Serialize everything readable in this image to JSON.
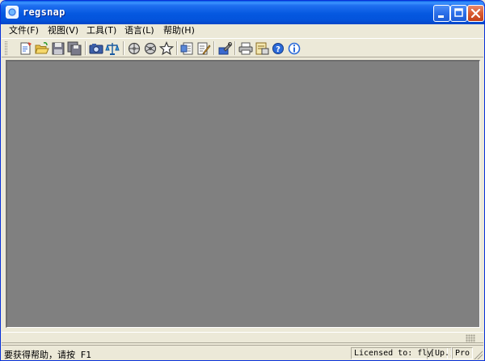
{
  "window": {
    "title": "regsnap",
    "controls": [
      "minimize",
      "maximize",
      "close"
    ]
  },
  "menu": {
    "items": [
      {
        "label": "文件(F)"
      },
      {
        "label": "视图(V)"
      },
      {
        "label": "工具(T)"
      },
      {
        "label": "语言(L)"
      },
      {
        "label": "帮助(H)"
      }
    ]
  },
  "toolbar": {
    "groups": [
      [
        "new-snapshot-icon",
        "open-folder-icon",
        "save-icon",
        "save-all-icon"
      ],
      [
        "camera-icon",
        "compare-icon"
      ],
      [
        "network-icon",
        "network-compare-icon",
        "favorite-star-icon"
      ],
      [
        "report-icon",
        "edit-icon"
      ],
      [
        "settings-wrench-icon"
      ],
      [
        "print-icon",
        "print-preview-icon",
        "help-icon",
        "info-icon"
      ]
    ]
  },
  "status": {
    "hint": "要获得帮助，请按 F1",
    "license": "Licensed to: fly",
    "upgrade": "[Up.]",
    "edition": "Pro"
  },
  "colors": {
    "titlebar": "#0558e0",
    "client_background": "#808080",
    "chrome": "#ece9d8"
  }
}
